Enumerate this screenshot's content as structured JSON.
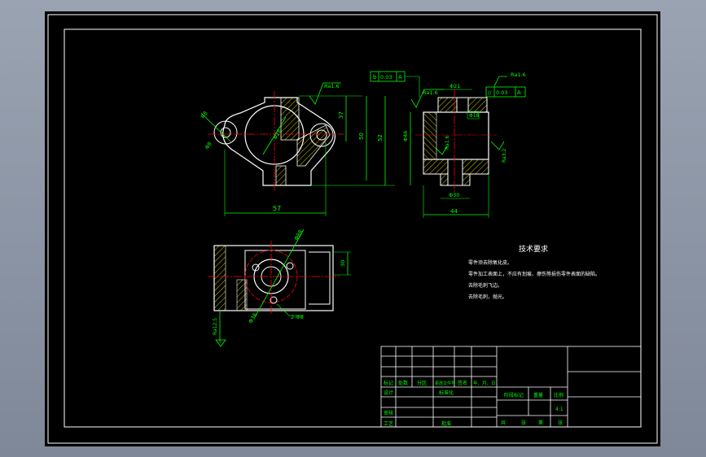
{
  "colors": {
    "background": "#000000",
    "frame": "#ffffff",
    "geometry": "#ffffff",
    "dimension": "#00ff00",
    "centerline": "#ff0000",
    "hatch": "#ffff00",
    "annotation": "#00ff00",
    "text": "#ffffff",
    "outline": "#00ffff"
  },
  "views": {
    "front": {
      "dim_bottom": "57",
      "dim_right_1": "37",
      "dim_right_2": "50",
      "dim_right_3": "52",
      "roughness": "Ra1.6",
      "dim_diag_1": "R8",
      "dim_diag_2": "Φ8",
      "dim_center": "Φ28"
    },
    "side": {
      "tol_left_symbol": "b",
      "tol_left_value": "0.03",
      "tol_left_datum": "A",
      "tol_right_symbol": "//",
      "tol_right_value": "0.03",
      "tol_right_datum": "A",
      "roughness_top_left": "Ra1.6",
      "roughness_top_right": "Ra1.6",
      "dim_top": "Φ21",
      "dim_inner": "Φ18",
      "dim_left": "Φ46",
      "roughness_mid": "Ra1.6",
      "roughness_right": "Ra3.2",
      "dim_bottom_small": "Φ30",
      "dim_bottom": "44"
    },
    "top": {
      "dim_diag_top": "Φ88",
      "dim_right": "30",
      "dim_diag_bottom": "Φ36",
      "dim_holes": "2-Φ8",
      "roughness_left": "Ra12.5"
    }
  },
  "tech": {
    "title": "技术要求",
    "items": [
      "零件须去除氧化皮。",
      "零件加工表面上，不应有划痕、擦伤等损伤零件表面的缺陷。",
      "去除毛刺飞边。",
      "去除毛刺，抛光。"
    ]
  },
  "title_block": {
    "row_headers": [
      "标记",
      "处数",
      "分区",
      "更改文件号",
      "签名",
      "年、月、日"
    ],
    "design": "设计",
    "standardization": "标准化",
    "review": "审核",
    "process": "工艺",
    "approve": "批准",
    "stage_mark": "阶段标记",
    "weight": "重量",
    "scale": "比例",
    "scale_value": "4:1",
    "sheets_total": "共",
    "sheets_unit": "张",
    "sheet_no": "第",
    "sheet_unit2": "张"
  }
}
